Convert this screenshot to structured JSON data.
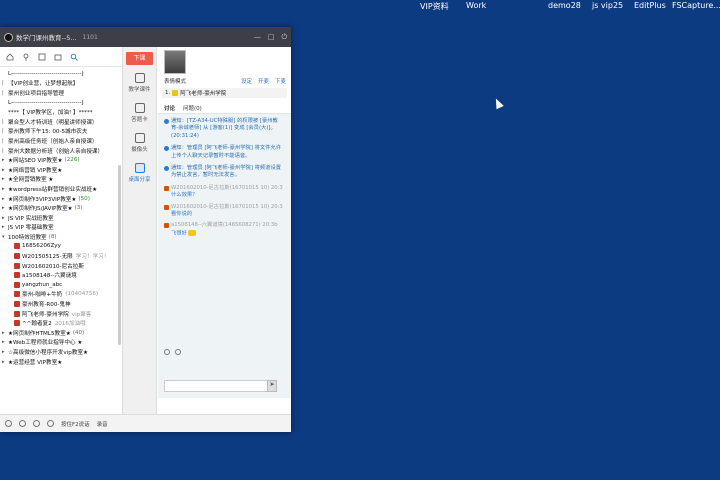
{
  "desktop": {
    "labels": [
      "VIP资料",
      "Work",
      "demo28",
      "js vip25",
      "EditPlus",
      "FSCapture..."
    ]
  },
  "window": {
    "title": "数学门课州教育--5...",
    "uid": "1101",
    "controls": [
      "—",
      "□",
      "⏻"
    ]
  },
  "left_rows": [
    {
      "arrow": "",
      "text": "L-----------------------------------J"
    },
    {
      "arrow": "|",
      "text": "【VIP创业营，让梦想起航】"
    },
    {
      "arrow": "|",
      "text": "豪州创业项目指导管理"
    },
    {
      "arrow": "",
      "text": "L-----------------------------------J"
    },
    {
      "arrow": "",
      "text": "****【 VIP教学区，加油! 】*****"
    },
    {
      "arrow": "|",
      "text": "聚合型人才特训班（明星讲师授课）"
    },
    {
      "arrow": "|",
      "text": "豪州教师下午15: 00-5城市农夫"
    },
    {
      "arrow": "|",
      "text": "豪州高级任务班（创始人亲自授课）"
    },
    {
      "arrow": "|",
      "text": "豪州大数据分析班（创始人亲自授课）"
    },
    {
      "arrow": "▸",
      "text": "★网站SEO      VIP教室★",
      "cnt": "(226)"
    },
    {
      "arrow": "▸",
      "text": "★网络营销     VIP教室★"
    },
    {
      "arrow": "▸",
      "text": "★全网营销教室        ★"
    },
    {
      "arrow": "▸",
      "text": "★wordpress站群营销创业实战班★"
    },
    {
      "arrow": "▸",
      "text": "★网页制作3VIP3VIP教室★",
      "cnt": "(50)"
    },
    {
      "arrow": "▸",
      "text": "★网页制作JS/JAVIP教室★",
      "cnt": "(3)"
    },
    {
      "arrow": "▸",
      "text": "JS VIP 实战班教室"
    },
    {
      "arrow": "▸",
      "text": "JS VIP 零基础教室"
    },
    {
      "arrow": "▾",
      "text": "100特效班教室",
      "cnt": "(8)"
    },
    {
      "child": true,
      "text": "16856206Zyy"
    },
    {
      "child": true,
      "text": "W201505125-无限",
      "muted": "学习！学习！"
    },
    {
      "child": true,
      "text": "W201602010-尼古拉斯"
    },
    {
      "child": true,
      "text": "a1508148--六翼谜境"
    },
    {
      "child": true,
      "text": "yangzhun_abc"
    },
    {
      "child": true,
      "text": "豪州-咖啡+牛奶",
      "muted": "(10404756)"
    },
    {
      "child": true,
      "text": "豪州教育-R00-鬼神"
    },
    {
      "child": true,
      "text": "阿飞老师-豪州学院",
      "muted": "vip聚客"
    },
    {
      "child": true,
      "text": "^^翰者复2",
      "muted": "2016加油哦"
    },
    {
      "arrow": "▸",
      "text": "★网页制作HTML5教室★",
      "cnt": "(40)"
    },
    {
      "arrow": "▸",
      "text": "★Web工程师就业指导中心 ★"
    },
    {
      "arrow": "▸",
      "text": "☆高级微信小程序开发vip教室★"
    },
    {
      "arrow": "▸",
      "text": "★运营经营      VIP教室★"
    }
  ],
  "statusbar": {
    "items": [
      "按住F2说话",
      "录音"
    ]
  },
  "nav": {
    "top_button": "下课",
    "items": [
      "教学课件",
      "答题卡",
      "摄像头",
      "桌面分享"
    ]
  },
  "chat": {
    "tabs_label": "表情模式",
    "links": [
      "设定",
      "开麦",
      "下麦"
    ],
    "pinned": "阿飞老师-豪州学院",
    "pinned_prefix": "1.",
    "subtabs": [
      "讨论",
      "问题",
      "(0)"
    ],
    "notices": [
      "通知：[TZ-A34-UC特殊服]  的权限被 [豪州教育-余诚老师] 从 [游客(1)] 变成 [会员(大)]。(20:31:24)",
      "通知：管理员 [阿飞老师-豪州学院] 将文件允许上传个人聊天记录暂时不能语音。",
      "通知：管理员 [阿飞老师-豪州学院] 将频道设置为禁止发言，暂时无法发言。"
    ],
    "messages": [
      {
        "who": "W201602010-尼古拉斯(16701015 10) 20:3",
        "body": "什么效果？"
      },
      {
        "who": "W201602010-尼古拉斯(16701015 10) 20:3",
        "body": "看你说的"
      },
      {
        "who": "a1508148--六翼谜境(1465608271) 20:3b",
        "body": "飞哥好"
      }
    ]
  }
}
